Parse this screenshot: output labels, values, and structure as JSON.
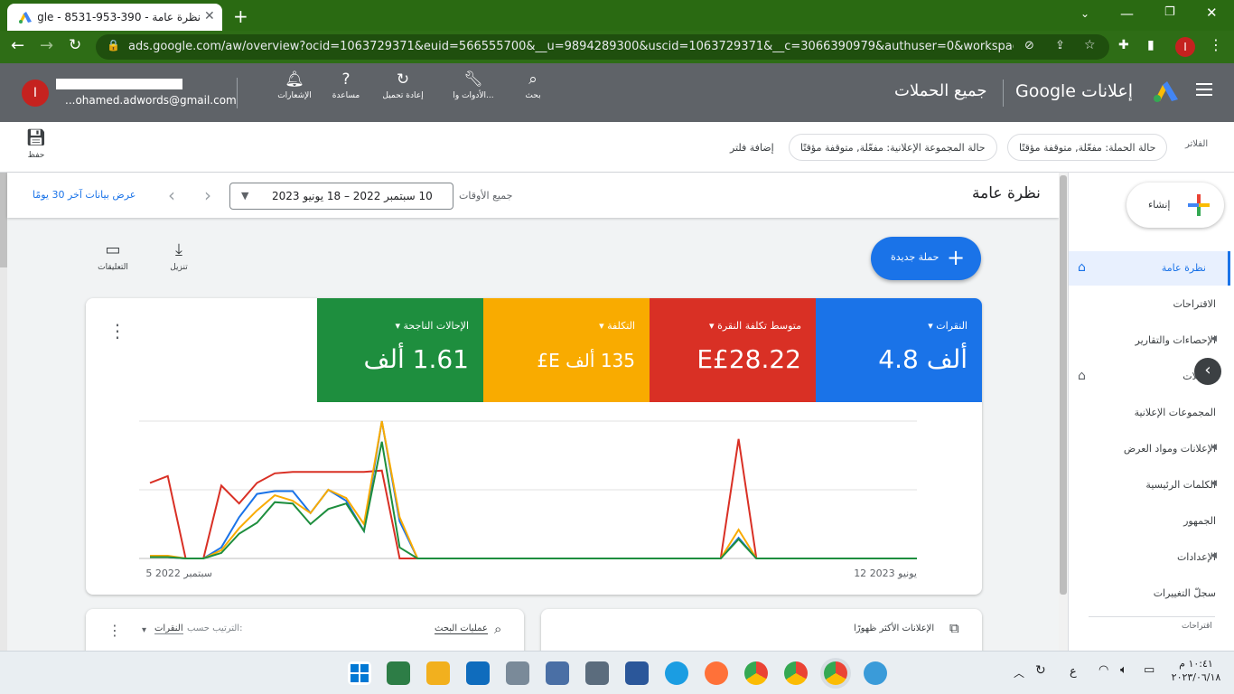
{
  "browser": {
    "tab_title": "نظرة عامة - 390-953-8531 - ogle",
    "url": "ads.google.com/aw/overview?ocid=1063729371&euid=566555700&__u=9894289300&uscid=1063729371&__c=3066390979&authuser=0&workspaceId=0&...",
    "profile_initial": "I"
  },
  "header": {
    "product": "إعلانات Google",
    "scope": "جميع الحملات",
    "account_email": "...ohamed.adwords@gmail.com",
    "avatar_initial": "I",
    "tools": [
      {
        "label": "بحث",
        "icon": "search-icon"
      },
      {
        "label": "الأدوات وا...",
        "icon": "wrench-icon"
      },
      {
        "label": "إعادة تحميل",
        "icon": "refresh-icon"
      },
      {
        "label": "مساعدة",
        "icon": "help-icon"
      },
      {
        "label": "الإشعارات",
        "icon": "bell-icon"
      }
    ]
  },
  "filters": {
    "label": "الفلاتر",
    "chips": [
      "حالة الحملة: مفعّلة, متوقفة مؤقتًا",
      "حالة المجموعة الإعلانية: مفعّلة, متوقفة مؤقتًا"
    ],
    "add_filter": "إضافة فلتر",
    "save": "حفظ"
  },
  "page": {
    "title": "نظرة عامة",
    "date_label": "جميع الأوقات",
    "date_range": "10 سبتمبر 2022 – 18 يونيو 2023",
    "last30": "عرض بيانات آخر 30 يومًا",
    "new_campaign": "حملة جديدة",
    "download": "تنزيل",
    "comments": "التعليقات"
  },
  "sidebar": {
    "create": "إنشاء",
    "items": [
      "نظرة عامة",
      "الاقتراحات",
      "الإحصاءات والتقارير",
      "الحملات",
      "المجموعات الإعلانية",
      "الإعلانات ومواد العرض",
      "الكلمات الرئيسية",
      "الجمهور",
      "الإعدادات",
      "سجلّ التغييرات"
    ],
    "section_footer": "اقتراحات"
  },
  "kpis": [
    {
      "label": "النقرات",
      "value": "4.8 ألف",
      "color": "#1a73e8"
    },
    {
      "label": "متوسط تكلفة النقرة",
      "value": "E£28.22",
      "color": "#d93025"
    },
    {
      "label": "التكلفة",
      "value": "135 ألف E£",
      "color": "#f9ab00"
    },
    {
      "label": "الإحالات الناجحة",
      "value": "1.61 ألف",
      "color": "#1e8e3e"
    }
  ],
  "chart_data": {
    "type": "line",
    "x_start_label": "5 سبتمبر 2022",
    "x_end_label": "12 يونيو 2023",
    "ylim": [
      0,
      100
    ],
    "grid": true,
    "series": [
      {
        "color": "#d93025",
        "values": [
          55,
          60,
          0,
          0,
          53,
          40,
          55,
          62,
          63,
          63,
          63,
          63,
          63,
          64,
          0,
          0,
          0,
          0,
          0,
          0,
          0,
          0,
          0,
          0,
          0,
          0,
          0,
          0,
          0,
          0,
          0,
          0,
          0,
          87,
          0,
          0,
          0,
          0,
          0,
          0,
          0,
          0,
          0,
          0
        ]
      },
      {
        "color": "#1a73e8",
        "values": [
          2,
          1,
          0,
          0,
          8,
          30,
          47,
          49,
          49,
          33,
          50,
          42,
          20,
          100,
          27,
          0,
          0,
          0,
          0,
          0,
          0,
          0,
          0,
          0,
          0,
          0,
          0,
          0,
          0,
          0,
          0,
          0,
          0,
          15,
          0,
          0,
          0,
          0,
          0,
          0,
          0,
          0,
          0,
          0
        ]
      },
      {
        "color": "#f9ab00",
        "values": [
          2,
          2,
          0,
          0,
          6,
          22,
          35,
          46,
          42,
          33,
          50,
          44,
          25,
          100,
          30,
          0,
          0,
          0,
          0,
          0,
          0,
          0,
          0,
          0,
          0,
          0,
          0,
          0,
          0,
          0,
          0,
          0,
          0,
          21,
          0,
          0,
          0,
          0,
          0,
          0,
          0,
          0,
          0,
          0
        ]
      },
      {
        "color": "#1e8e3e",
        "values": [
          1,
          1,
          0,
          0,
          4,
          18,
          26,
          41,
          40,
          25,
          36,
          40,
          20,
          85,
          8,
          0,
          0,
          0,
          0,
          0,
          0,
          0,
          0,
          0,
          0,
          0,
          0,
          0,
          0,
          0,
          0,
          0,
          0,
          14,
          0,
          0,
          0,
          0,
          0,
          0,
          0,
          0,
          0,
          0
        ]
      }
    ]
  },
  "bottom_cards": {
    "left_title": "الإعلانات الأكثر ظهورًا",
    "right_title": "عمليات البحث",
    "sort_label": "الترتيب حسب:",
    "sort_value": "النقرات"
  },
  "taskbar": {
    "lang": "ع",
    "time": "١٠:٤١ م",
    "date": "٢٠٢٣/٠٦/١٨"
  }
}
